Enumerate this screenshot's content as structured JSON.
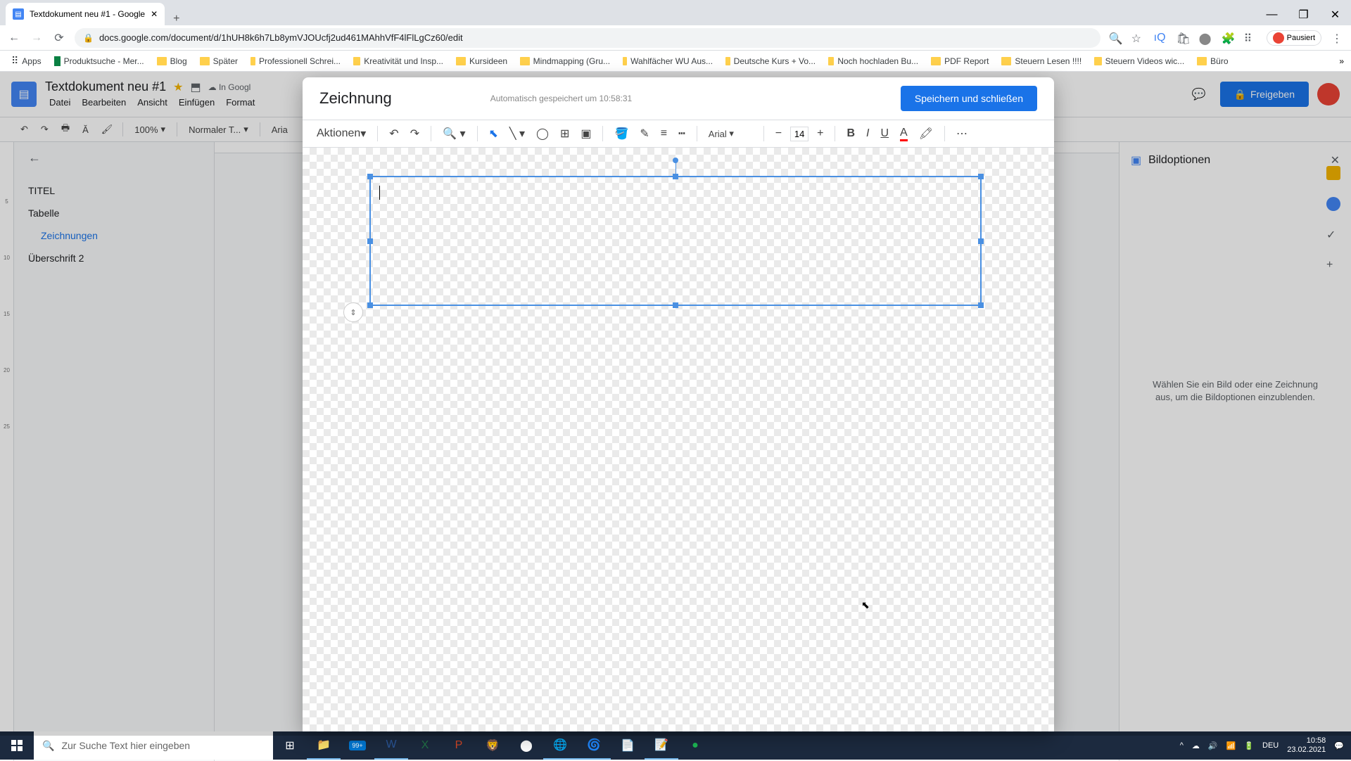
{
  "browser": {
    "tab_title": "Textdokument neu #1 - Google",
    "url": "docs.google.com/document/d/1hUH8k6h7Lb8ymVJOUcfj2ud461MAhhVfF4lFlLgCz60/edit",
    "paused_label": "Pausiert"
  },
  "bookmarks": [
    {
      "label": "Apps",
      "type": "apps"
    },
    {
      "label": "Produktsuche - Mer...",
      "type": "icon"
    },
    {
      "label": "Blog",
      "type": "folder"
    },
    {
      "label": "Später",
      "type": "folder"
    },
    {
      "label": "Professionell Schrei...",
      "type": "folder"
    },
    {
      "label": "Kreativität und Insp...",
      "type": "folder"
    },
    {
      "label": "Kursideen",
      "type": "folder"
    },
    {
      "label": "Mindmapping (Gru...",
      "type": "folder"
    },
    {
      "label": "Wahlfächer WU Aus...",
      "type": "folder"
    },
    {
      "label": "Deutsche Kurs + Vo...",
      "type": "folder"
    },
    {
      "label": "Noch hochladen Bu...",
      "type": "folder"
    },
    {
      "label": "PDF Report",
      "type": "folder"
    },
    {
      "label": "Steuern Lesen !!!!",
      "type": "folder"
    },
    {
      "label": "Steuern Videos wic...",
      "type": "folder"
    },
    {
      "label": "Büro",
      "type": "folder"
    }
  ],
  "docs": {
    "title": "Textdokument neu #1",
    "cloud_status": "In Googl",
    "menus": [
      "Datei",
      "Bearbeiten",
      "Ansicht",
      "Einfügen",
      "Format"
    ],
    "share_label": "Freigeben",
    "zoom": "100%",
    "style_select": "Normaler T...",
    "font_select": "Aria"
  },
  "outline": {
    "items": [
      {
        "text": "TITEL",
        "level": 0
      },
      {
        "text": "Tabelle",
        "level": 0
      },
      {
        "text": "Zeichnungen",
        "level": 1
      },
      {
        "text": "Überschrift 2",
        "level": 0
      }
    ]
  },
  "sidebar": {
    "title": "Bildoptionen",
    "hint": "Wählen Sie ein Bild oder eine Zeichnung aus, um die Bildoptionen einzublenden."
  },
  "draw_modal": {
    "title": "Zeichnung",
    "saved_msg": "Automatisch gespeichert um 10:58:31",
    "save_btn": "Speichern und schließen",
    "actions_label": "Aktionen",
    "font": "Arial",
    "fontsize": "14"
  },
  "taskbar": {
    "search_placeholder": "Zur Suche Text hier eingeben",
    "notif_count": "99+",
    "lang": "DEU",
    "time": "10:58",
    "date": "23.02.2021"
  },
  "ruler_marks": [
    "",
    "",
    "",
    "5",
    "",
    "10",
    "",
    "15",
    "",
    "20",
    "",
    "25",
    ""
  ]
}
